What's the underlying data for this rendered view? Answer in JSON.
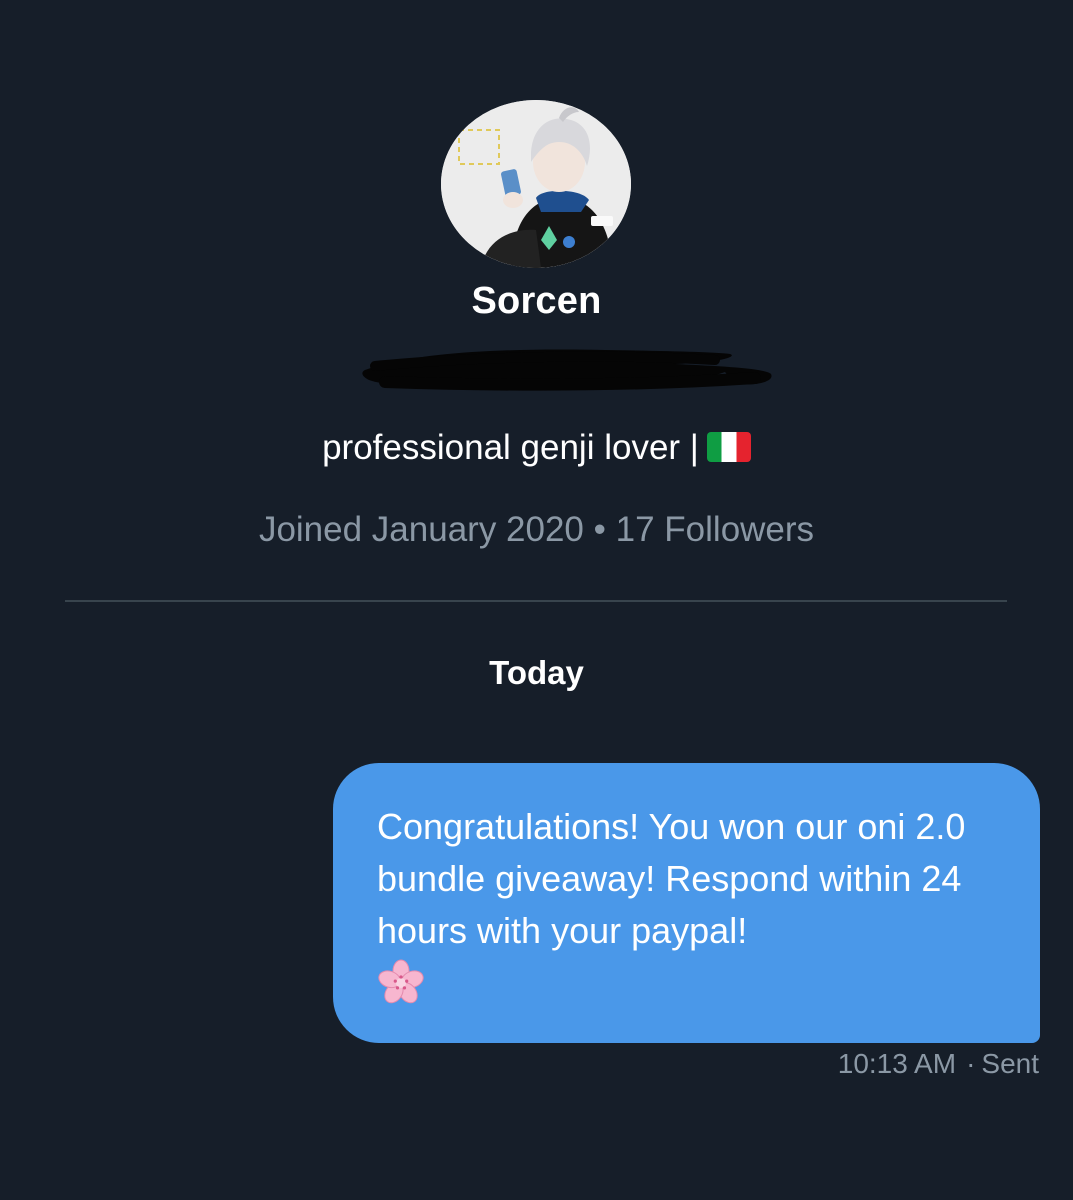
{
  "profile": {
    "display_name": "Sorcen",
    "bio": "professional genji lover |",
    "bio_flag_icon": "italy-flag-icon",
    "joined": "Joined January 2020",
    "separator": "•",
    "followers": "17 Followers"
  },
  "conversation": {
    "date_label": "Today",
    "messages": [
      {
        "direction": "sent",
        "text": "Congratulations! You won our oni 2.0 bundle giveaway! Respond within 24 hours with your paypal!",
        "emoji_icon": "cherry-blossom-icon",
        "time": "10:13 AM",
        "meta_separator": "·",
        "status": "Sent"
      }
    ]
  },
  "colors": {
    "background": "#161e29",
    "bubble": "#4a98e9",
    "muted_text": "#8b98a5",
    "divider": "#38444d"
  }
}
